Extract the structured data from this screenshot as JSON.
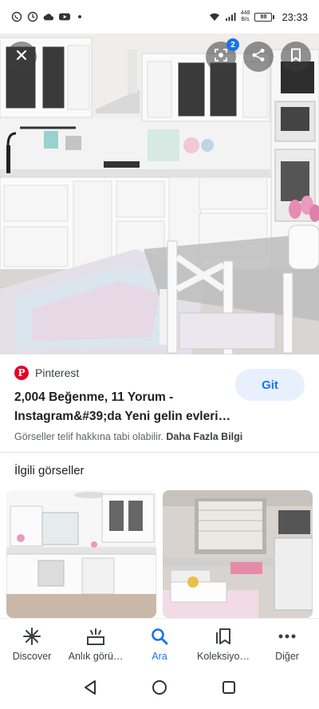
{
  "status_bar": {
    "net_speed_value": "448",
    "net_speed_unit": "B/s",
    "battery": "88",
    "time": "23:33"
  },
  "image_viewer": {
    "badge_count": "2",
    "icons": [
      "close-icon",
      "lens-icon",
      "share-icon",
      "bookmark-icon"
    ]
  },
  "result": {
    "source": "Pinterest",
    "go_label": "Git",
    "title": "2,004 Beğenme, 11 Yorum - Instagram&#39;da Yeni gelin evleri…",
    "copyright_note": "Görseller telif hakkına tabi olabilir.",
    "more_info": "Daha Fazla Bilgi"
  },
  "related": {
    "heading": "İlgili görseller"
  },
  "bottom_nav": {
    "items": [
      {
        "label": "Discover",
        "icon": "asterisk-icon"
      },
      {
        "label": "Anlık görü…",
        "icon": "updates-icon"
      },
      {
        "label": "Ara",
        "icon": "search-icon",
        "active": true
      },
      {
        "label": "Koleksiyo…",
        "icon": "collections-icon"
      },
      {
        "label": "Diğer",
        "icon": "more-icon"
      }
    ]
  },
  "colors": {
    "accent": "#1a73e8",
    "pinterest": "#e60023",
    "button_bg": "#e8f0fe"
  }
}
